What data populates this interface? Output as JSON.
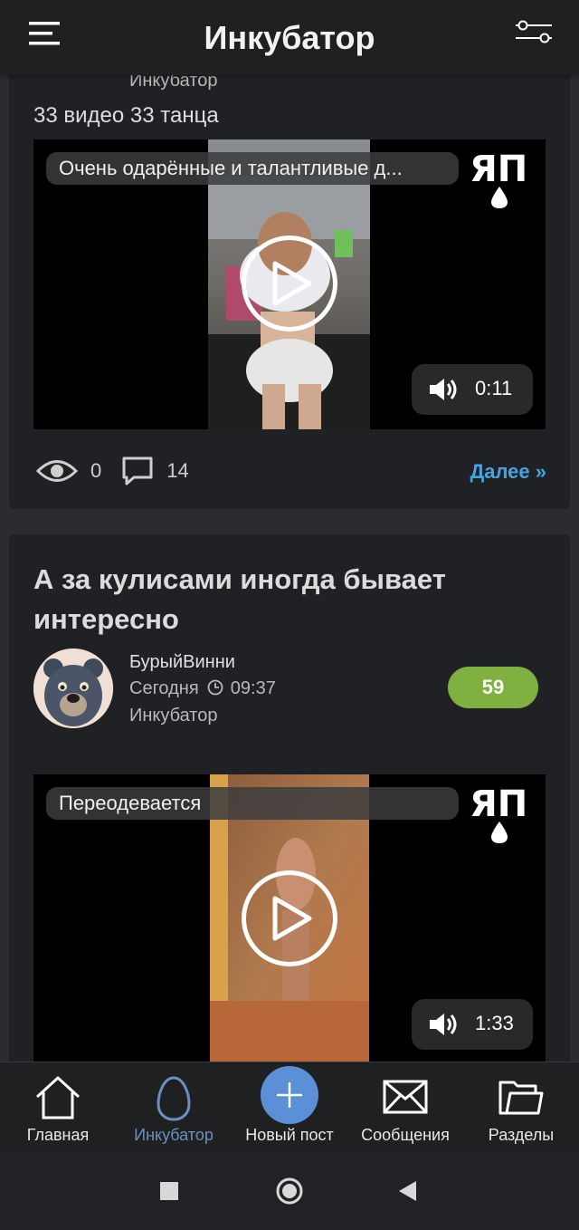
{
  "header": {
    "title": "Инкубатор"
  },
  "posts": [
    {
      "category": "Инкубатор",
      "subtitle": "33 видео 33 танца",
      "video": {
        "caption": "Очень одарённые и талантливые д...",
        "duration": "0:11",
        "logo": "ЯП"
      },
      "views": "0",
      "comments": "14",
      "more_label": "Далее »"
    },
    {
      "title": "А за кулисами иногда бывает интересно",
      "author": "БурыйВинни",
      "date": "Сегодня",
      "time": "09:37",
      "category": "Инкубатор",
      "rating": "59",
      "video": {
        "caption": "Переодевается",
        "duration": "1:33",
        "logo": "ЯП"
      }
    }
  ],
  "nav": {
    "items": [
      {
        "label": "Главная",
        "icon": "home-icon"
      },
      {
        "label": "Инкубатор",
        "icon": "egg-icon",
        "active": true
      },
      {
        "label": "Новый пост",
        "icon": "plus-icon"
      },
      {
        "label": "Сообщения",
        "icon": "envelope-icon"
      },
      {
        "label": "Разделы",
        "icon": "folder-icon"
      }
    ]
  },
  "colors": {
    "accent": "#4aa3e0",
    "rating": "#7fb040",
    "nav_active": "#6f8fc0",
    "plus_button": "#5b8fd6"
  }
}
